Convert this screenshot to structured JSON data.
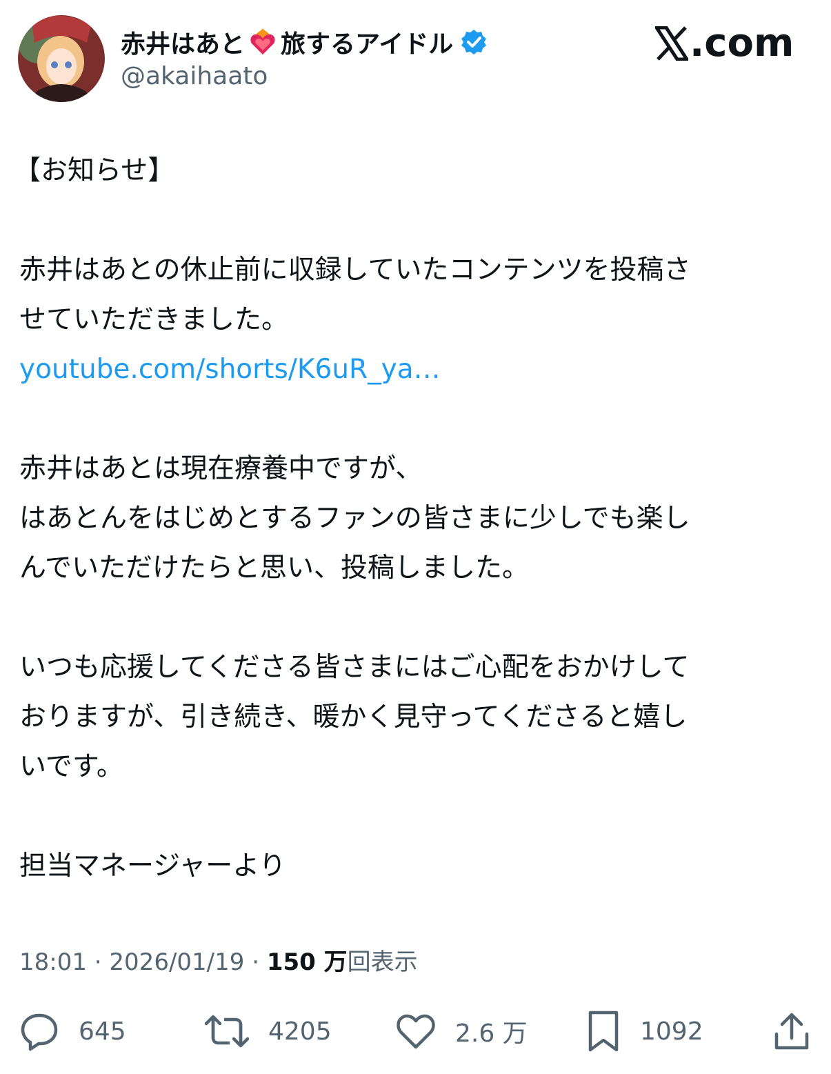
{
  "header": {
    "display_name_part1": "赤井はあと",
    "display_name_part2": "旅するアイドル",
    "handle": "@akaihaato",
    "brand": ".com",
    "icons": [
      "avatar",
      "heart-on-fire-emoji-icon",
      "verified-badge-icon",
      "x-logo-icon"
    ],
    "colors": {
      "verified": "#1d9bf0",
      "heart": "#e0245e"
    }
  },
  "tweet": {
    "lines": [
      "【お知らせ】",
      "",
      "赤井はあとの休止前に収録していたコンテンツを投稿さ",
      "せていただきました。",
      "youtube.com/shorts/K6uR_ya…",
      "",
      "赤井はあとは現在療養中ですが、",
      "はあとんをはじめとするファンの皆さまに少しでも楽し",
      "んでいただけたらと思い、投稿しました。",
      "",
      "いつも応援してくださる皆さまにはご心配をおかけして",
      "おりますが、引き続き、暖かく見守ってくださると嬉し",
      "いです。",
      "",
      "担当マネージャーより"
    ],
    "link_color": "#1d9bf0"
  },
  "meta": {
    "time": "18:01",
    "separator": " · ",
    "date": "2026/01/19",
    "views_count": "150 万",
    "views_label": "回表示"
  },
  "actions": {
    "replies": "645",
    "reposts": "4205",
    "likes": "2.6 万",
    "bookmarks": "1092",
    "icons": [
      "reply-icon",
      "repost-icon",
      "like-icon",
      "bookmark-icon",
      "share-icon"
    ]
  }
}
